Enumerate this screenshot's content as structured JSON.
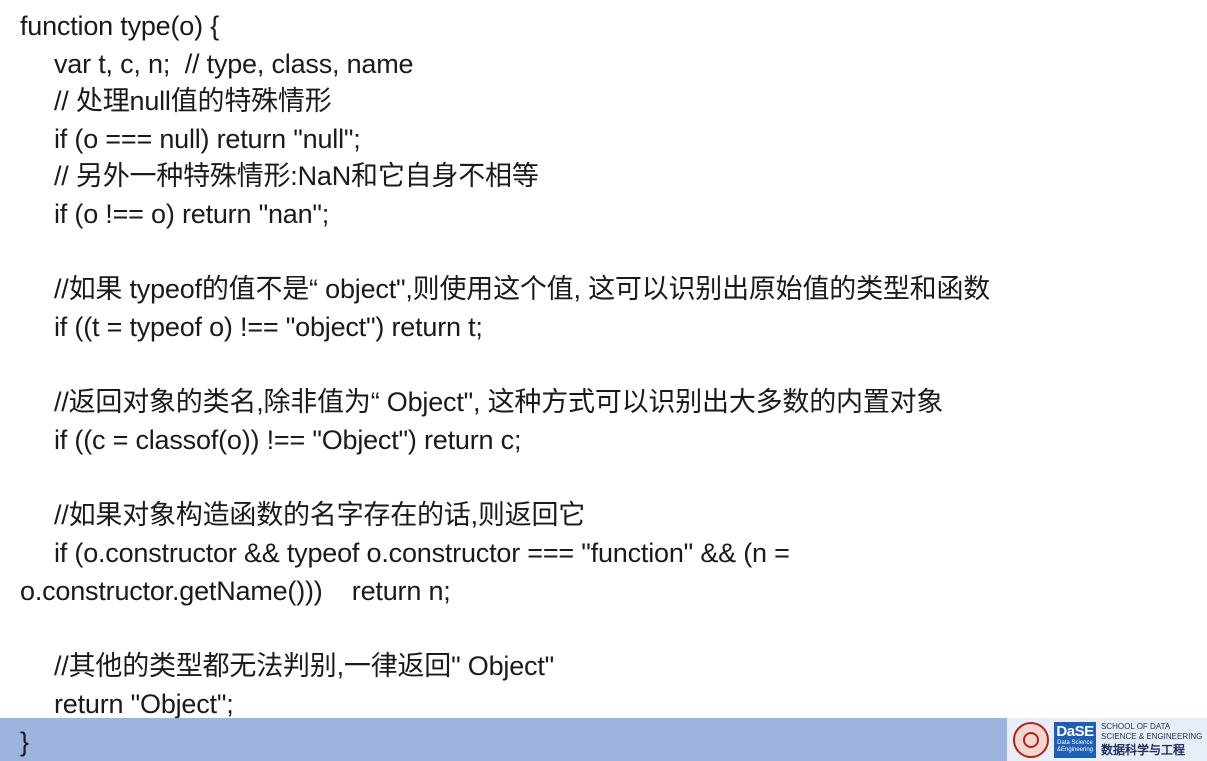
{
  "code_lines": [
    "function type(o) {",
    "var t, c, n;  // type, class, name",
    "// 处理null值的特殊情形",
    "if (o === null) return \"null\";",
    "// 另外一种特殊情形:NaN和它自身不相等",
    "if (o !== o) return \"nan\";",
    "//如果 typeof的值不是“ object\",则使用这个值, 这可以识别出原始值的类型和函数",
    "if ((t = typeof o) !== \"object\") return t;",
    "//返回对象的类名,除非值为“ Object\", 这种方式可以识别出大多数的内置对象",
    "if ((c = classof(o)) !== \"Object\") return c;",
    "//如果对象构造函数的名字存在的话,则返回它",
    "if (o.constructor && typeof o.constructor === \"function\" && (n =",
    "o.constructor.getName()))    return n;",
    "//其他的类型都无法判别,一律返回\" Object\"",
    "return \"Object\";",
    "}"
  ],
  "footer": {
    "bar_color": "#9db4de",
    "logo_text": "DaSE",
    "logo_sub_1": "Data Science",
    "logo_sub_2": "&Engineering",
    "school_en_1": "SCHOOL OF DATA",
    "school_en_2": "SCIENCE & ENGINEERING",
    "school_cn": "数据科学与工程"
  }
}
